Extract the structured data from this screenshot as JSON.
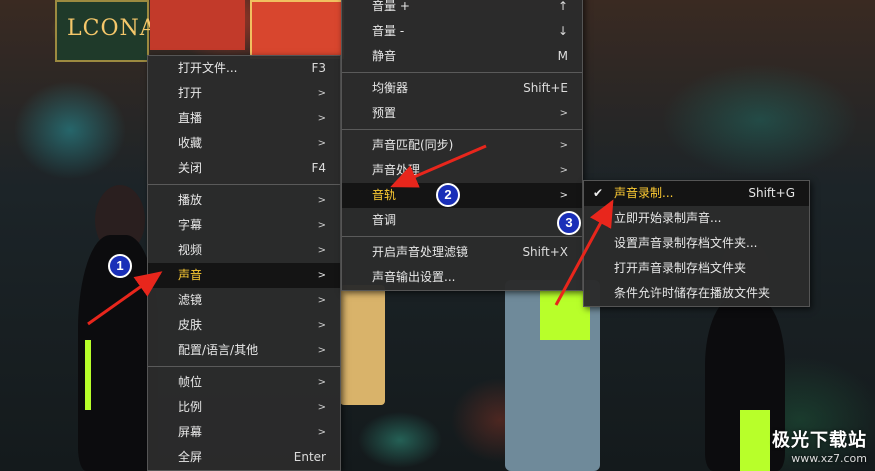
{
  "background": {
    "sign_text": "LCONA"
  },
  "menu1": {
    "items": [
      {
        "label": "打开文件...",
        "shortcut": "F3",
        "sub": false
      },
      {
        "label": "打开",
        "shortcut": "",
        "sub": true
      },
      {
        "label": "直播",
        "shortcut": "",
        "sub": true
      },
      {
        "label": "收藏",
        "shortcut": "",
        "sub": true
      },
      {
        "label": "关闭",
        "shortcut": "F4",
        "sub": false
      },
      {
        "label": "播放",
        "shortcut": "",
        "sub": true
      },
      {
        "label": "字幕",
        "shortcut": "",
        "sub": true
      },
      {
        "label": "视频",
        "shortcut": "",
        "sub": true
      },
      {
        "label": "声音",
        "shortcut": "",
        "sub": true
      },
      {
        "label": "滤镜",
        "shortcut": "",
        "sub": true
      },
      {
        "label": "皮肤",
        "shortcut": "",
        "sub": true
      },
      {
        "label": "配置/语言/其他",
        "shortcut": "",
        "sub": true
      },
      {
        "label": "帧位",
        "shortcut": "",
        "sub": true
      },
      {
        "label": "比例",
        "shortcut": "",
        "sub": true
      },
      {
        "label": "屏幕",
        "shortcut": "",
        "sub": true
      },
      {
        "label": "全屏",
        "shortcut": "Enter",
        "sub": false
      }
    ]
  },
  "menu2": {
    "items": [
      {
        "label": "音量 +",
        "shortcut": "↑"
      },
      {
        "label": "音量 -",
        "shortcut": "↓"
      },
      {
        "label": "静音",
        "shortcut": "M"
      },
      {
        "label": "均衡器",
        "shortcut": "Shift+E"
      },
      {
        "label": "预置",
        "shortcut": ""
      },
      {
        "label": "声音匹配(同步)",
        "shortcut": ""
      },
      {
        "label": "声音处理",
        "shortcut": ""
      },
      {
        "label": "音轨",
        "shortcut": ""
      },
      {
        "label": "音调",
        "shortcut": ""
      },
      {
        "label": "开启声音处理滤镜",
        "shortcut": "Shift+X"
      },
      {
        "label": "声音输出设置...",
        "shortcut": ""
      }
    ]
  },
  "menu3": {
    "items": [
      {
        "label": "声音录制...",
        "shortcut": "Shift+G"
      },
      {
        "label": "立即开始录制声音..."
      },
      {
        "label": "设置声音录制存档文件夹..."
      },
      {
        "label": "打开声音录制存档文件夹"
      },
      {
        "label": "条件允许时储存在播放文件夹"
      }
    ]
  },
  "annotations": {
    "badge1": "1",
    "badge2": "2",
    "badge3": "3",
    "arrow_color": "#e8261c",
    "badge_color": "#1a2fb8"
  },
  "watermark": {
    "title": "极光下载站",
    "url": "www.xz7.com"
  },
  "colors": {
    "menu_bg": "#2b2b2b",
    "highlight_text": "#ffcc33"
  }
}
